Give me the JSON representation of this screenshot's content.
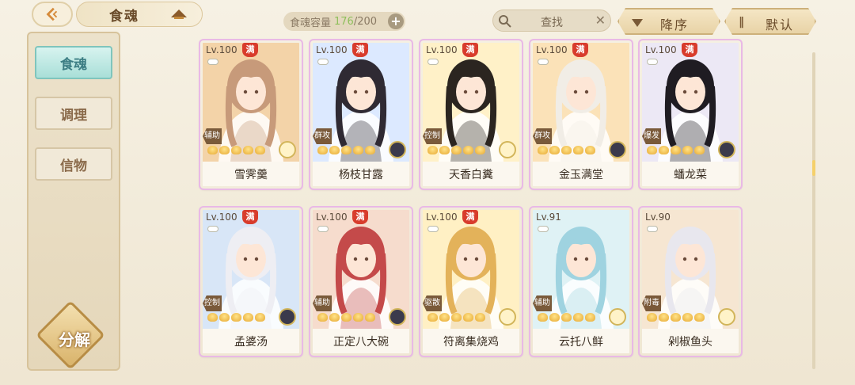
{
  "header": {
    "title": "食魂",
    "capacity_label": "食魂容量",
    "capacity_current": "176",
    "capacity_max": "/200",
    "capacity_add": "+",
    "search_placeholder": "查找",
    "search_clear": "✕",
    "sort_label": "降序",
    "default_label": "默认",
    "default_icon": "‖"
  },
  "sidebar": {
    "items": [
      {
        "label": "食魂",
        "active": true
      },
      {
        "label": "调理",
        "active": false
      },
      {
        "label": "信物",
        "active": false
      }
    ],
    "decompose_label": "分解"
  },
  "cards": [
    {
      "level": "Lv.100",
      "max_badge": "满",
      "role": "辅助",
      "name": "雪霁羹",
      "stars": 5,
      "accent": "#f3d3a8",
      "hair": "#c79a7a",
      "emblem": "light"
    },
    {
      "level": "Lv.100",
      "max_badge": "满",
      "role": "群攻",
      "name": "杨枝甘露",
      "stars": 5,
      "accent": "#dce9ff",
      "hair": "#2f2a33",
      "emblem": "dark"
    },
    {
      "level": "Lv.100",
      "max_badge": "满",
      "role": "控制",
      "name": "天香白糞",
      "stars": 5,
      "accent": "#fff1c8",
      "hair": "#2b2520",
      "emblem": "light"
    },
    {
      "level": "Lv.100",
      "max_badge": "满",
      "role": "群攻",
      "name": "金玉满堂",
      "stars": 5,
      "accent": "#fbe2b8",
      "hair": "#f1ede6",
      "emblem": "dark"
    },
    {
      "level": "Lv.100",
      "max_badge": "满",
      "role": "爆发",
      "name": "蟠龙菜",
      "stars": 5,
      "accent": "#ece8f5",
      "hair": "#1f1c22",
      "emblem": "dark"
    },
    {
      "level": "Lv.100",
      "max_badge": "满",
      "role": "控制",
      "name": "孟婆汤",
      "stars": 5,
      "accent": "#d8e6f7",
      "hair": "#eeeef3",
      "emblem": "dark"
    },
    {
      "level": "Lv.100",
      "max_badge": "满",
      "role": "辅助",
      "name": "正定八大碗",
      "stars": 5,
      "accent": "#f6dccd",
      "hair": "#c44a4a",
      "emblem": "dark"
    },
    {
      "level": "Lv.100",
      "max_badge": "满",
      "role": "驱散",
      "name": "符离集烧鸡",
      "stars": 5,
      "accent": "#fff0c4",
      "hair": "#e3b25a",
      "emblem": "light"
    },
    {
      "level": "Lv.91",
      "max_badge": "",
      "role": "辅助",
      "name": "云托八鲜",
      "stars": 5,
      "accent": "#dff2f5",
      "hair": "#9fd3e0",
      "emblem": "light"
    },
    {
      "level": "Lv.90",
      "max_badge": "",
      "role": "附毒",
      "name": "剁椒鱼头",
      "stars": 5,
      "accent": "#f6e6d2",
      "hair": "#e8e7ee",
      "emblem": "light"
    }
  ]
}
